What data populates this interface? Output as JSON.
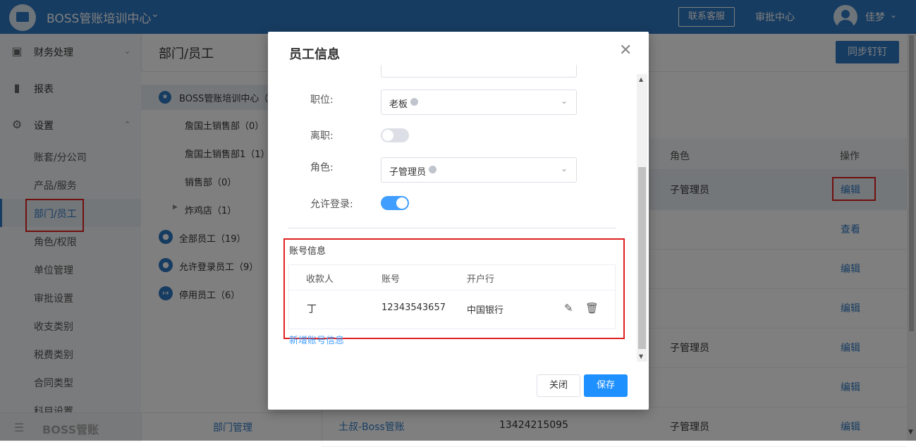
{
  "topbar": {
    "company": "BOSS管账培训中心",
    "contact_label": "联系客服",
    "approval_label": "审批中心",
    "username": "佳梦"
  },
  "sidebar": {
    "groups": [
      {
        "label": "财务处理",
        "icon": "wallet-icon"
      },
      {
        "label": "报表",
        "icon": "bar-chart-icon"
      },
      {
        "label": "设置",
        "icon": "gear-icon"
      }
    ],
    "sub_items": [
      "账套/分公司",
      "产品/服务",
      "部门/员工",
      "角色/权限",
      "单位管理",
      "审批设置",
      "收支类别",
      "税费类别",
      "合同类型",
      "科目设置"
    ],
    "active_index": 2,
    "footer_label": "BOSS管账"
  },
  "main": {
    "title": "部门/员工",
    "sync_label": "同步钉钉"
  },
  "departments": {
    "root": "BOSS管账培训中心（",
    "children": [
      "詹国土销售部（0）",
      "詹国土销售部1（1）",
      "销售部（0）",
      "炸鸡店（1）"
    ],
    "groups": [
      "全部员工（19）",
      "允许登录员工（9）",
      "停用员工（6）"
    ],
    "footer_label": "部门管理"
  },
  "table": {
    "headers": {
      "role": "角色",
      "action": "操作"
    },
    "rows": [
      {
        "role": "子管理员",
        "action": "编辑"
      },
      {
        "role": "",
        "action": "查看"
      },
      {
        "role": "",
        "action": "编辑"
      },
      {
        "role": "",
        "action": "编辑"
      },
      {
        "role": "子管理员",
        "action": "编辑"
      },
      {
        "role": "",
        "action": "编辑"
      },
      {
        "name": "土叔-Boss管账",
        "phone": "13424215095",
        "role": "子管理员",
        "action": "编辑"
      }
    ]
  },
  "modal": {
    "title": "员工信息",
    "position_label": "职位:",
    "position_value": "老板",
    "resigned_label": "离职:",
    "resigned_on": false,
    "role_label": "角色:",
    "role_value": "子管理员",
    "login_label": "允许登录:",
    "login_on": true,
    "account_section_title": "账号信息",
    "account_headers": [
      "收款人",
      "账号",
      "开户行"
    ],
    "accounts": [
      {
        "payee": "丁",
        "number": "12343543657",
        "bank": "中国银行"
      }
    ],
    "add_account_label": "新增账号信息",
    "close_label": "关闭",
    "save_label": "保存"
  },
  "colors": {
    "primary": "#2f78c2",
    "save_button": "#1e90ff",
    "toggle_on": "#409eff",
    "highlight_box": "#e02020"
  }
}
